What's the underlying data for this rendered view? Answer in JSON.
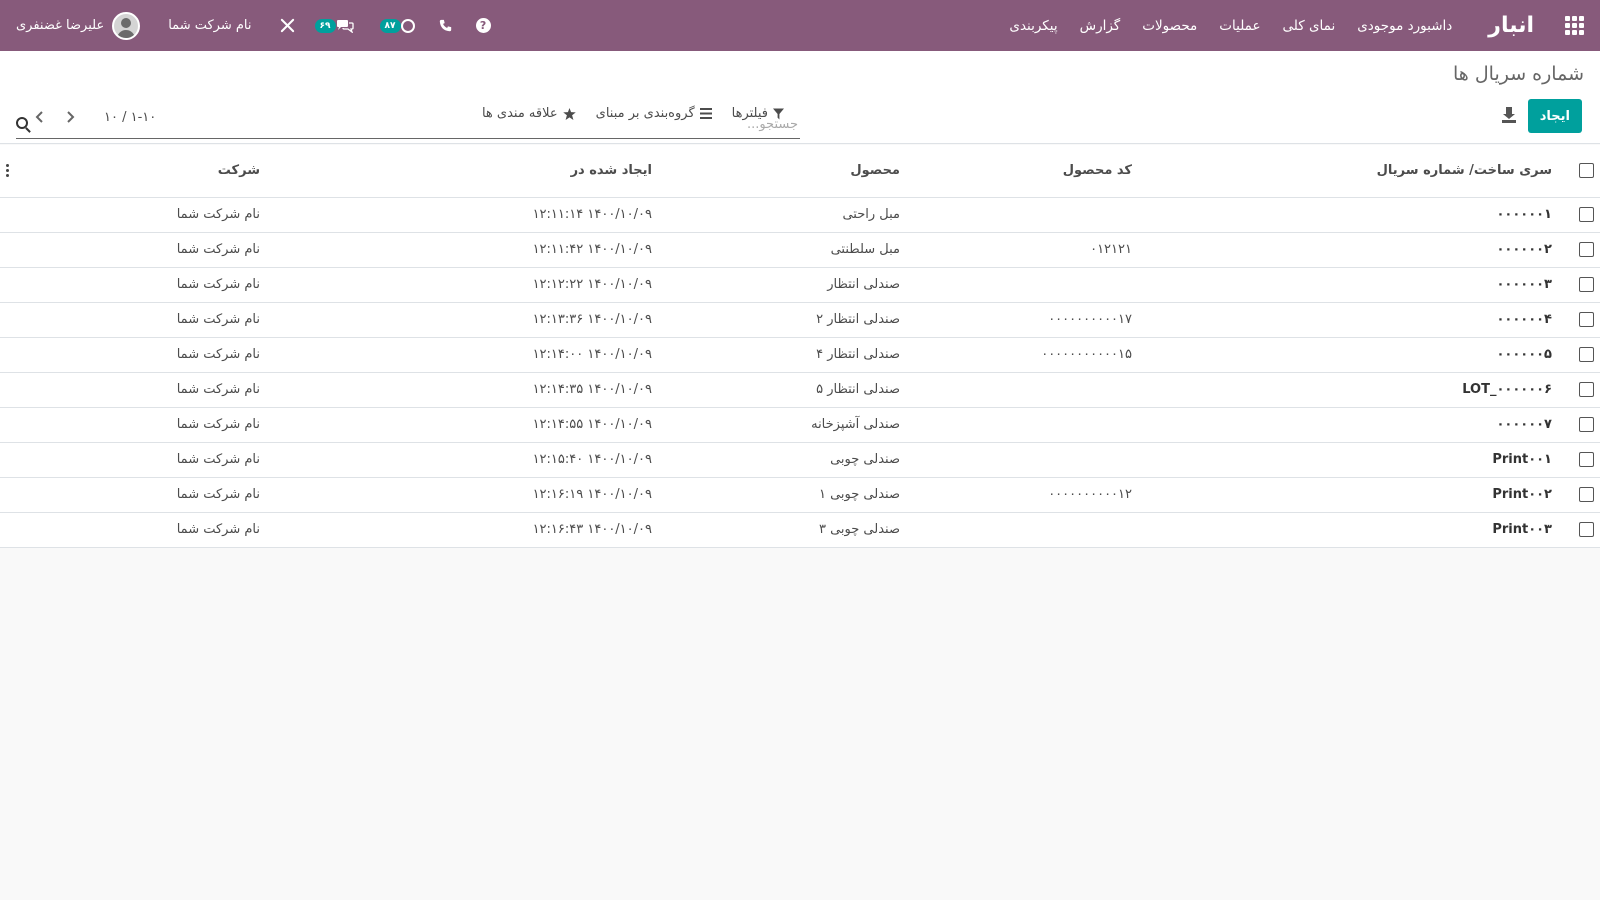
{
  "navbar": {
    "brand": "انبار",
    "menu": [
      "داشبورد موجودی",
      "نمای کلی",
      "عملیات",
      "محصولات",
      "گزارش",
      "پیکربندی"
    ],
    "user_name": "علیرضا غضنفری",
    "company_name": "نام شرکت شما",
    "messages_count": "۶۹",
    "activities_count": "۸۷"
  },
  "control": {
    "title": "شماره سریال ها",
    "search_placeholder": "جستجو...",
    "create_label": "ایجاد",
    "filters_label": "فیلترها",
    "groupby_label": "گروه‌بندی بر مبنای",
    "favorites_label": "علاقه مندی ها",
    "pager_value": "۱-۱۰ / ۱۰"
  },
  "table": {
    "headers": {
      "lot": "سری ساخت/ شماره سریال",
      "code": "کد محصول",
      "product": "محصول",
      "created": "ایجاد شده در",
      "company": "شرکت"
    },
    "rows": [
      {
        "lot": "۰۰۰۰۰۰۱",
        "code": "",
        "product": "مبل راحتی",
        "created": "۱۴۰۰/۱۰/۰۹ ۱۲:۱۱:۱۴",
        "company": "نام شرکت شما"
      },
      {
        "lot": "۰۰۰۰۰۰۲",
        "code": "۰۱۲۱۲۱",
        "product": "مبل سلطنتی",
        "created": "۱۴۰۰/۱۰/۰۹ ۱۲:۱۱:۴۲",
        "company": "نام شرکت شما"
      },
      {
        "lot": "۰۰۰۰۰۰۳",
        "code": "",
        "product": "صندلی انتظار",
        "created": "۱۴۰۰/۱۰/۰۹ ۱۲:۱۲:۲۲",
        "company": "نام شرکت شما"
      },
      {
        "lot": "۰۰۰۰۰۰۴",
        "code": "۰۰۰۰۰۰۰۰۰۰۱۷",
        "product": "صندلی انتظار ۲",
        "created": "۱۴۰۰/۱۰/۰۹ ۱۲:۱۳:۳۶",
        "company": "نام شرکت شما"
      },
      {
        "lot": "۰۰۰۰۰۰۵",
        "code": "۰۰۰۰۰۰۰۰۰۰۰۱۵",
        "product": "صندلی انتظار ۴",
        "created": "۱۴۰۰/۱۰/۰۹ ۱۲:۱۴:۰۰",
        "company": "نام شرکت شما"
      },
      {
        "lot": "LOT_۰۰۰۰۰۰۶",
        "code": "",
        "product": "صندلی انتظار ۵",
        "created": "۱۴۰۰/۱۰/۰۹ ۱۲:۱۴:۳۵",
        "company": "نام شرکت شما"
      },
      {
        "lot": "۰۰۰۰۰۰۷",
        "code": "",
        "product": "صندلی آشپزخانه",
        "created": "۱۴۰۰/۱۰/۰۹ ۱۲:۱۴:۵۵",
        "company": "نام شرکت شما"
      },
      {
        "lot": "Print۰۰۱",
        "code": "",
        "product": "صندلی چوبی",
        "created": "۱۴۰۰/۱۰/۰۹ ۱۲:۱۵:۴۰",
        "company": "نام شرکت شما"
      },
      {
        "lot": "Print۰۰۲",
        "code": "۰۰۰۰۰۰۰۰۰۰۱۲",
        "product": "صندلی چوبی ۱",
        "created": "۱۴۰۰/۱۰/۰۹ ۱۲:۱۶:۱۹",
        "company": "نام شرکت شما"
      },
      {
        "lot": "Print۰۰۳",
        "code": "",
        "product": "صندلی چوبی ۳",
        "created": "۱۴۰۰/۱۰/۰۹ ۱۲:۱۶:۴۳",
        "company": "نام شرکت شما"
      }
    ]
  },
  "colors": {
    "navbar": "#875a7b",
    "primary_button": "#00a09d",
    "badge": "#00a09d"
  }
}
